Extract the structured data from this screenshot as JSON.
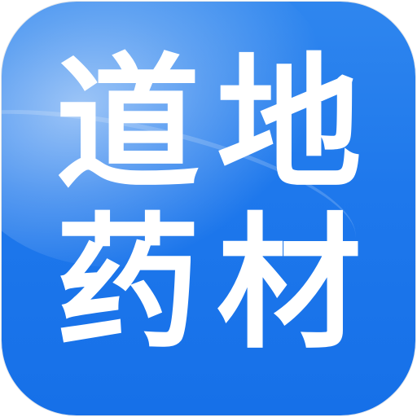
{
  "icon": {
    "characters": [
      "道",
      "地",
      "药",
      "材"
    ],
    "background_color": "#1e78ec",
    "text_color": "#ffffff"
  }
}
